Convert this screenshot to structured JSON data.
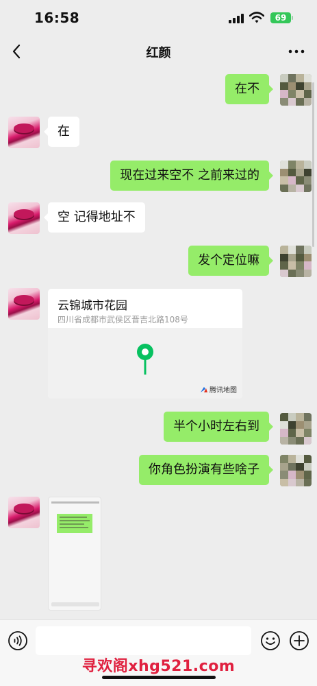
{
  "status_bar": {
    "time": "16:58",
    "battery": "69"
  },
  "header": {
    "title": "红颜"
  },
  "messages": [
    {
      "from": "me",
      "type": "text",
      "text": "在不"
    },
    {
      "from": "contact",
      "type": "text",
      "text": "在"
    },
    {
      "from": "me",
      "type": "text",
      "text": "现在过来空不  之前来过的"
    },
    {
      "from": "contact",
      "type": "text",
      "text": "空 记得地址不"
    },
    {
      "from": "me",
      "type": "text",
      "text": "发个定位嘛"
    },
    {
      "from": "contact",
      "type": "location",
      "title": "云锦城市花园",
      "address": "四川省成都市武侯区晋吉北路108号",
      "provider": "腾讯地图"
    },
    {
      "from": "me",
      "type": "text",
      "text": "半个小时左右到"
    },
    {
      "from": "me",
      "type": "text",
      "text": "你角色扮演有些啥子"
    },
    {
      "from": "contact",
      "type": "image"
    }
  ],
  "input_bar": {
    "placeholder": ""
  },
  "watermark": "寻欢阁xhg521.com",
  "colors": {
    "outgoing_bubble": "#95ec69",
    "incoming_bubble": "#ffffff",
    "background": "#ededed",
    "map_pin": "#07c160",
    "watermark": "#e0203f"
  },
  "icons": [
    "back-icon",
    "more-icon",
    "signal-icon",
    "wifi-icon",
    "battery-icon",
    "map-pin-icon",
    "voice-icon",
    "emoji-icon",
    "plus-icon"
  ]
}
